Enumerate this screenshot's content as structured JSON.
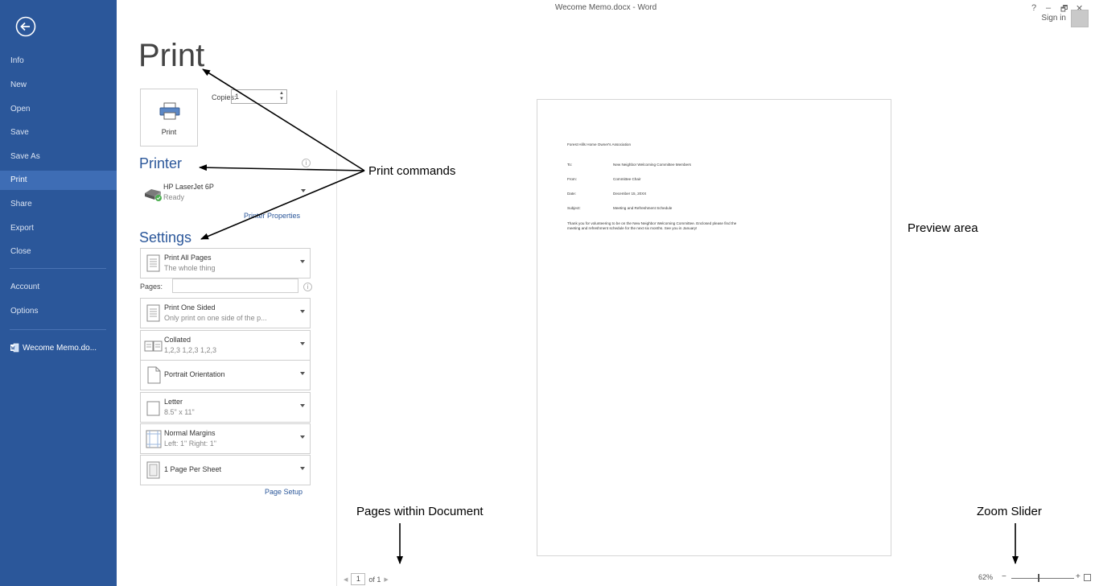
{
  "window": {
    "title": "Wecome Memo.docx - Word",
    "help": "?",
    "minimize": "–",
    "restore": "🗗",
    "close": "✕",
    "sign_in": "Sign in"
  },
  "sidebar": {
    "items": [
      {
        "label": "Info"
      },
      {
        "label": "New"
      },
      {
        "label": "Open"
      },
      {
        "label": "Save"
      },
      {
        "label": "Save As"
      },
      {
        "label": "Print"
      },
      {
        "label": "Share"
      },
      {
        "label": "Export"
      },
      {
        "label": "Close"
      },
      {
        "label": "Account"
      },
      {
        "label": "Options"
      }
    ],
    "active": "Print",
    "recent_doc": "Wecome Memo.do..."
  },
  "print_panel": {
    "title": "Print",
    "print_button": "Print",
    "copies_label": "Copies:",
    "copies_value": "1",
    "printer_heading": "Printer",
    "printer_name": "HP LaserJet 6P",
    "printer_status": "Ready",
    "printer_properties": "Printer Properties",
    "settings_heading": "Settings",
    "pages_label": "Pages:",
    "page_setup": "Page Setup",
    "settings": [
      {
        "main": "Print All Pages",
        "sub": "The whole thing"
      },
      {
        "main": "Print One Sided",
        "sub": "Only print on one side of the p..."
      },
      {
        "main": "Collated",
        "sub": "1,2,3   1,2,3   1,2,3"
      },
      {
        "main": "Portrait Orientation",
        "sub": ""
      },
      {
        "main": "Letter",
        "sub": "8.5\" x 11\""
      },
      {
        "main": "Normal Margins",
        "sub": "Left: 1\"   Right: 1\""
      },
      {
        "main": "1 Page Per Sheet",
        "sub": ""
      }
    ]
  },
  "document": {
    "org": "Forest Hills Home Owner's Association",
    "to_label": "To:",
    "to": "New Neighbor Welcoming Committee Members",
    "from_label": "From:",
    "from": "Committee Chair",
    "date_label": "Date:",
    "date": "December 15, 20XX",
    "subject_label": "Subject:",
    "subject": "Meeting and Refreshment Schedule",
    "body_line1": "Thank you for volunteering to be on the New Neighbor Welcoming Committee. Enclosed please find the",
    "body_line2": "meeting and refreshment schedule for the next six months. See you in January!"
  },
  "annotations": {
    "print_commands": "Print commands",
    "preview_area": "Preview area",
    "pages_within_document": "Pages within Document",
    "zoom_slider": "Zoom Slider"
  },
  "footer": {
    "prev": "◀",
    "current_page": "1",
    "of_pages": "of 1",
    "next": "▶",
    "zoom": "62%",
    "zoom_percent": 62
  }
}
